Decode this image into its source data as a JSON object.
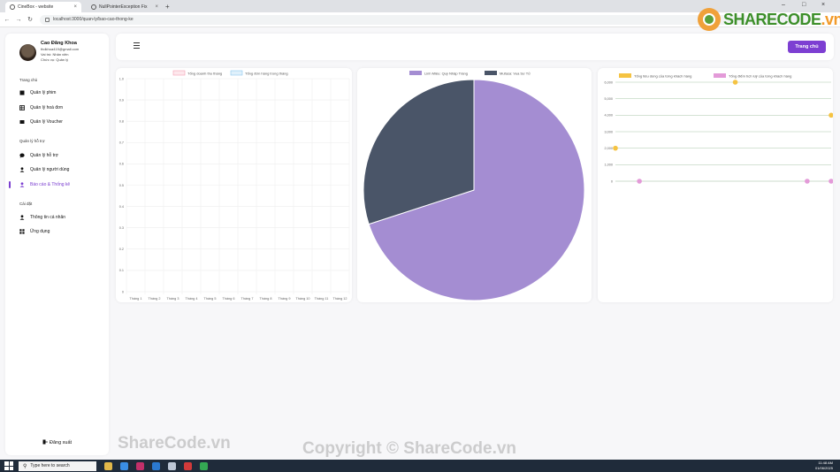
{
  "browser": {
    "tabs": [
      {
        "title": "CineBox - website",
        "active": true
      },
      {
        "title": "NullPointerException Fix",
        "active": false
      }
    ],
    "url": "localhost:3000/quan-ly/bao-cao-thong-ke"
  },
  "sidebar": {
    "user": {
      "name": "Cao Đăng Khoa",
      "email": "thdkhoa419@gmail.com",
      "role": "Vai trò: Nhân viên",
      "position": "Chức vụ: Quản lý"
    },
    "sections": [
      {
        "title": "Trang chủ",
        "items": [
          {
            "label": "Quản lý phim",
            "icon": "film-icon"
          },
          {
            "label": "Quản lý hoá đơn",
            "icon": "table-icon"
          },
          {
            "label": "Quản lý Voucher",
            "icon": "ticket-icon"
          }
        ]
      },
      {
        "title": "Quản lý hỗ trợ",
        "items": [
          {
            "label": "Quản lý hỗ trợ",
            "icon": "chat-icon"
          },
          {
            "label": "Quản lý người dùng",
            "icon": "user-icon"
          },
          {
            "label": "Báo cáo & Thống kê",
            "icon": "user-icon",
            "active": true
          }
        ]
      },
      {
        "title": "Cài đặt",
        "items": [
          {
            "label": "Thông tin cá nhân",
            "icon": "user-icon"
          },
          {
            "label": "Ứng dụng",
            "icon": "apps-icon"
          }
        ]
      }
    ],
    "logout": "Đăng xuất"
  },
  "header": {
    "home_button": "Trang chủ"
  },
  "watermark": {
    "logo_text": "SHARECODE",
    "logo_suffix": ".vn",
    "left_text": "ShareCode.vn",
    "center_text": "Copyright © ShareCode.vn"
  },
  "taskbar": {
    "search_placeholder": "Type here to search",
    "time": "11:48 AM",
    "date": "01/06/2025"
  },
  "colors": {
    "accent": "#7d3fd2",
    "pie_1": "#a48dd2",
    "pie_2": "#4a5568",
    "spend": "#f5c342",
    "points": "#e39ad8"
  },
  "chart_data": [
    {
      "type": "bar",
      "categories": [
        "Tháng 1",
        "Tháng 2",
        "Tháng 3",
        "Tháng 4",
        "Tháng 5",
        "Tháng 6",
        "Tháng 7",
        "Tháng 8",
        "Tháng 9",
        "Tháng 10",
        "Tháng 11",
        "Tháng 12"
      ],
      "series": [
        {
          "name": "Tổng doanh thu tháng",
          "values": [
            0,
            0,
            0,
            0,
            0,
            0,
            0,
            0,
            0,
            0,
            0,
            0
          ]
        },
        {
          "name": "Tổng đơn hàng trong tháng",
          "values": [
            0,
            0,
            0,
            0,
            0,
            0,
            0,
            0,
            0,
            0,
            0,
            0
          ]
        }
      ],
      "ylim": [
        0,
        1.0
      ],
      "yticks": [
        "1.0",
        "0.9",
        "0.8",
        "0.7",
        "0.6",
        "0.5",
        "0.4",
        "0.3",
        "0.2",
        "0.1",
        "0"
      ],
      "legend": "top",
      "grid": true
    },
    {
      "type": "pie",
      "labels": [
        "Linh Miêu: Quỷ Nhập Tràng",
        "Mufasa: Vua Sư Tử"
      ],
      "values": [
        70,
        30
      ],
      "legend": "top"
    },
    {
      "type": "line",
      "x": [
        1,
        2,
        3,
        4,
        5,
        6,
        7,
        8,
        9,
        10
      ],
      "series": [
        {
          "name": "Tổng tiêu dùng của từng khách hàng",
          "values": [
            2000,
            null,
            null,
            null,
            null,
            6000,
            null,
            null,
            null,
            4000
          ]
        },
        {
          "name": "Tổng điểm tích luỹ của từng khách hàng",
          "values": [
            null,
            0,
            null,
            null,
            null,
            null,
            null,
            null,
            0,
            0
          ]
        }
      ],
      "ylim": [
        0,
        6000
      ],
      "yticks": [
        "6,000",
        "5,000",
        "4,000",
        "3,000",
        "2,000",
        "1,000",
        "0"
      ],
      "legend": "top",
      "grid": true
    }
  ]
}
